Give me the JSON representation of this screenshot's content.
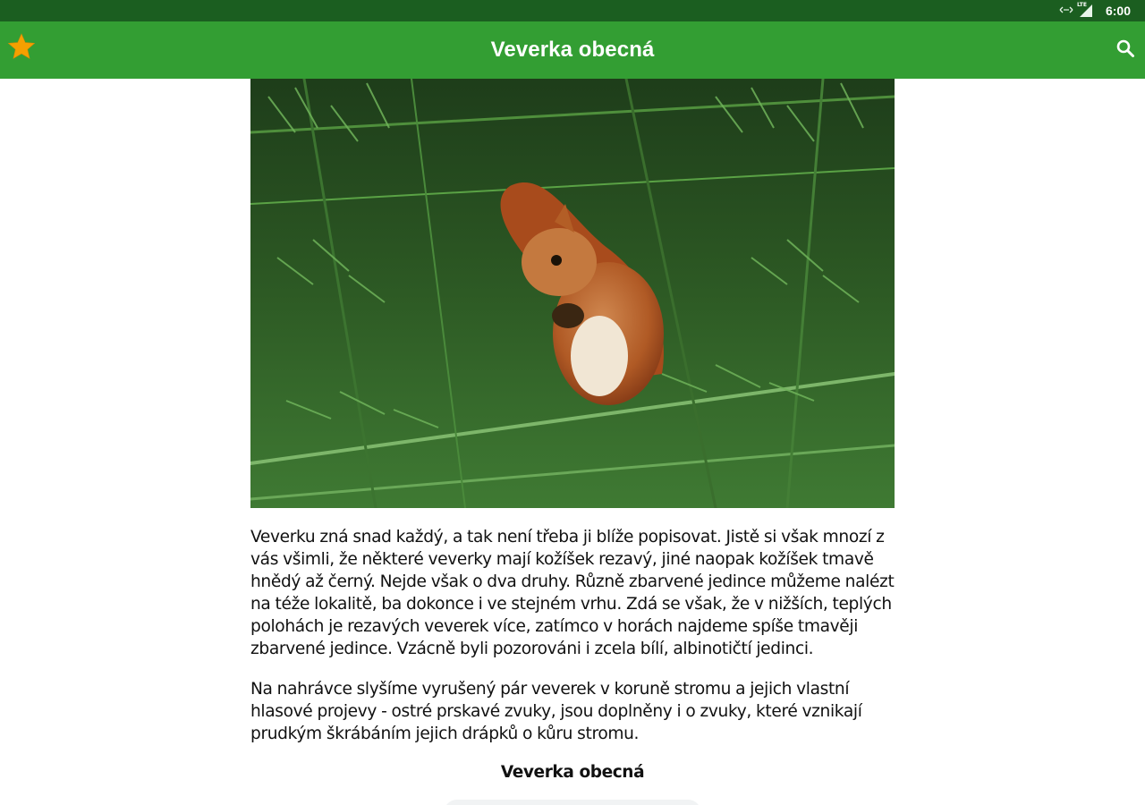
{
  "status_bar": {
    "time": "6:00",
    "network_label": "LTE",
    "icons": [
      "data-sync-icon",
      "cell-signal-icon"
    ]
  },
  "app_bar": {
    "title": "Veverka obecná",
    "left_icon": "star-icon",
    "right_icon": "search-icon",
    "colors": {
      "background": "#339e33",
      "star": "#f5a000",
      "status_bar": "#1b5e20"
    }
  },
  "article": {
    "image": "red-squirrel-in-spruce-photo",
    "paragraphs": [
      "Veverku zná snad každý, a tak není třeba ji blíže popisovat. Jistě si však mnozí z vás všimli, že některé veverky mají kožíšek rezavý, jiné naopak kožíšek tmavě hnědý až černý. Nejde však o dva druhy. Různě zbarvené jedince můžeme nalézt na téže lokalitě, ba dokonce i ve stejném vrhu. Zdá se však, že v nižších, teplých polohách je rezavých veverek více, zatímco v horách najdeme spíše tmavěji zbarvené jedince. Vzácně byli pozorováni i zcela bílí, albinotičtí jedinci.",
      "Na nahrávce slyšíme vyrušený pár veverek v koruně stromu a jejich vlastní hlasové projevy - ostré prskavé zvuky, jsou doplněny i o zvuky, které vznikají prudkým škrábáním jejich drápků o kůru stromu."
    ],
    "recording_title": "Veverka obecná"
  }
}
